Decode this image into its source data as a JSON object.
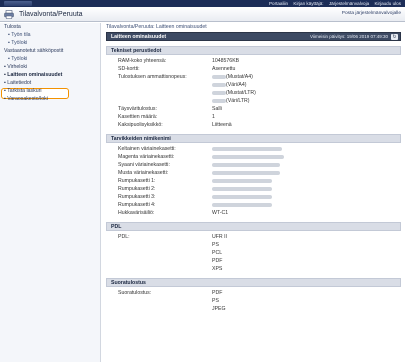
{
  "topbar": {
    "links": [
      "Portaaliin",
      "Kirjan käyttäjä:",
      "Järjestelmänvalvoja",
      "Kirjaudu ulos"
    ]
  },
  "header": {
    "title": "Tilavalvonta/Peruuta",
    "posta": "Posta järjestelmänvalvojalle"
  },
  "sidebar": {
    "items": [
      {
        "label": "Tulosta",
        "sub": false
      },
      {
        "label": "Työn tila",
        "sub": true
      },
      {
        "label": "Työloki",
        "sub": true
      },
      {
        "label": "Vastaanotetut sähköpostit",
        "sub": false
      },
      {
        "label": "Työloki",
        "sub": true
      },
      {
        "label": "Virheloki",
        "sub": false
      },
      {
        "label": "Laitteen ominaisuudet",
        "sub": false
      },
      {
        "label": "Laitetiedot",
        "sub": false
      },
      {
        "label": "Tarkista laskuri",
        "sub": false
      },
      {
        "label": "Varaosakesto/loki",
        "sub": false
      }
    ]
  },
  "main": {
    "breadcrumb": "Tilavalvonta/Peruuta: Laitteen ominaisuudet",
    "page_title": "Laitteen ominaisuudet",
    "updated": "Viimeisin päivitys: 19/06 2019 07:49:30",
    "sections": [
      {
        "title": "Tekniset perustiedot",
        "rows": [
          {
            "label": "RAM-koko yhteensä:",
            "values": [
              "1048576KB"
            ]
          },
          {
            "label": "SD-kortti:",
            "values": [
              "Asennettu"
            ]
          },
          {
            "label": "Tulostuksen ammattisnopeus:",
            "values": [
              "(Mustat/A4)",
              "(Väri/A4)",
              "(Mustat/LTR)",
              "(Väri/LTR)"
            ]
          },
          {
            "label": "Täysväritulostus:",
            "values": [
              "Salli"
            ]
          },
          {
            "label": "Kasettien määrä:",
            "values": [
              "1"
            ]
          },
          {
            "label": "Kaksipuolisyksikkö:",
            "values": [
              "Liitteenä"
            ]
          }
        ]
      },
      {
        "title": "Tarvikkeiden nimikenimi",
        "rows": [
          {
            "label": "Keltainen väriainekasetti:",
            "values": [
              ""
            ]
          },
          {
            "label": "Magenta väriainekasetti:",
            "values": [
              ""
            ]
          },
          {
            "label": "Syaani väriainekasetti:",
            "values": [
              ""
            ]
          },
          {
            "label": "Musta väriainekasetti:",
            "values": [
              ""
            ]
          },
          {
            "label": "Rumpukasetti 1:",
            "values": [
              ""
            ]
          },
          {
            "label": "Rumpukasetti 2:",
            "values": [
              ""
            ]
          },
          {
            "label": "Rumpukasetti 3:",
            "values": [
              ""
            ]
          },
          {
            "label": "Rumpukasetti 4:",
            "values": [
              ""
            ]
          },
          {
            "label": "Hukkavärisäiliö:",
            "values": [
              "WT-C1"
            ]
          }
        ]
      },
      {
        "title": "PDL",
        "rows": [
          {
            "label": "PDL:",
            "values": [
              "UFR II",
              "PS",
              "PCL",
              "PDF",
              "XPS"
            ]
          }
        ]
      },
      {
        "title": "Suoratulostus",
        "rows": [
          {
            "label": "Suoratulostus:",
            "values": [
              "PDF",
              "PS",
              "JPEG"
            ]
          }
        ]
      }
    ]
  },
  "colors": {
    "topbar": "#1c2d57",
    "accent_highlight": "#f39200",
    "section_header": "#d9dde6",
    "page_header": "#3d4a63"
  },
  "icons": {
    "app": "printer-icon",
    "refresh": "refresh-icon"
  }
}
